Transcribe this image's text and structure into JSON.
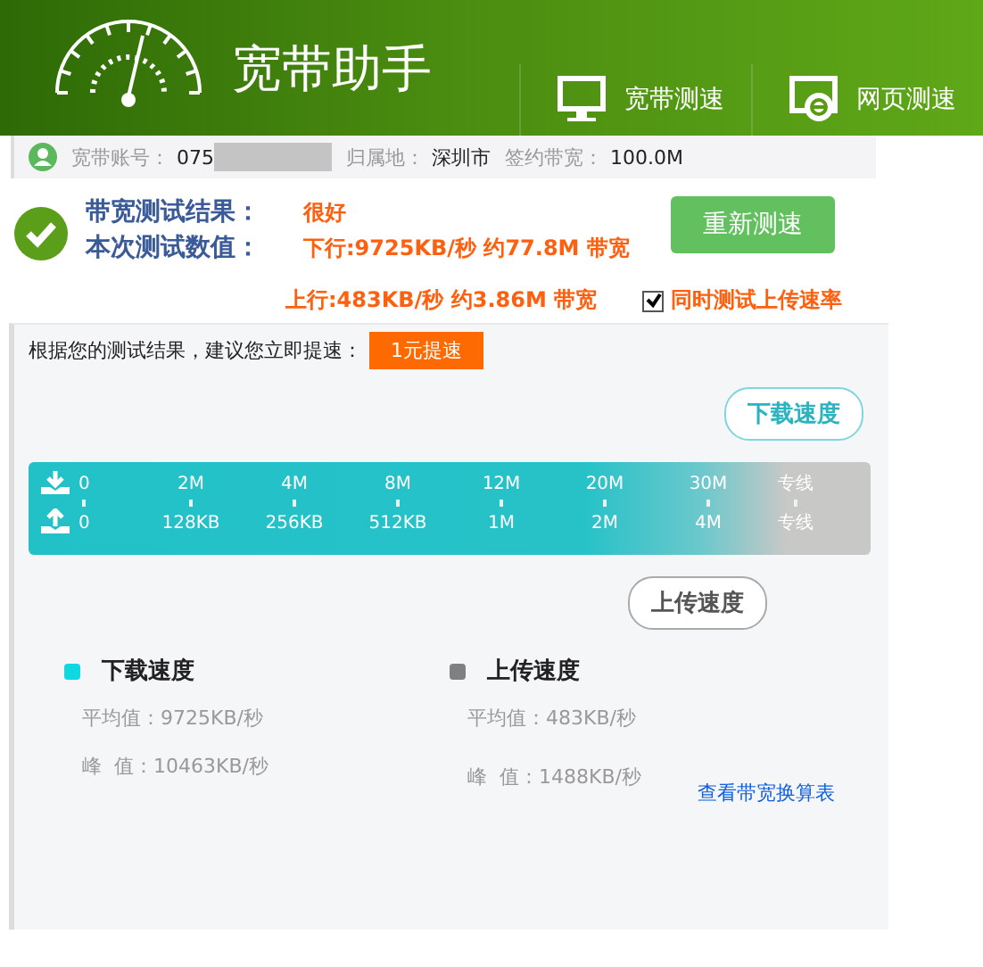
{
  "header": {
    "title": "宽带助手",
    "tabs": [
      {
        "label": "宽带测速",
        "kind": "monitor"
      },
      {
        "label": "网页测速",
        "kind": "browser"
      }
    ]
  },
  "account": {
    "account_label": "宽带账号：",
    "account_value": "075",
    "region_label": "归属地：",
    "region_value": "深圳市",
    "bandwidth_label": "签约带宽：",
    "bandwidth_value": "100.0M"
  },
  "result": {
    "result_label": "带宽测试结果：",
    "result_value": "很好",
    "value_label": "本次测试数值：",
    "download": "下行:9725KB/秒 约77.8M 带宽",
    "upload": "上行:483KB/秒 约3.86M 带宽",
    "retest_button": "重新测速",
    "upload_test": {
      "label": "同时测试上传速率",
      "checked": true
    }
  },
  "suggestion": {
    "text": "根据您的测试结果，建议您立即提速：",
    "button": "1元提速"
  },
  "scale": {
    "download_tag": "下载速度",
    "upload_tag": "上传速度",
    "download_ticks": [
      "0",
      "2M",
      "4M",
      "8M",
      "12M",
      "20M",
      "30M",
      "专线"
    ],
    "upload_ticks": [
      "0",
      "128KB",
      "256KB",
      "512KB",
      "1M",
      "2M",
      "4M",
      "专线"
    ]
  },
  "legend": [
    {
      "title": "下载速度",
      "color": "#10d8e0",
      "average": "平均值：9725KB/秒",
      "peak": "峰  值：10463KB/秒"
    },
    {
      "title": "上传速度",
      "color": "#808080",
      "average": "平均值：483KB/秒",
      "peak": "峰  值：1488KB/秒"
    }
  ],
  "link": "查看带宽换算表"
}
